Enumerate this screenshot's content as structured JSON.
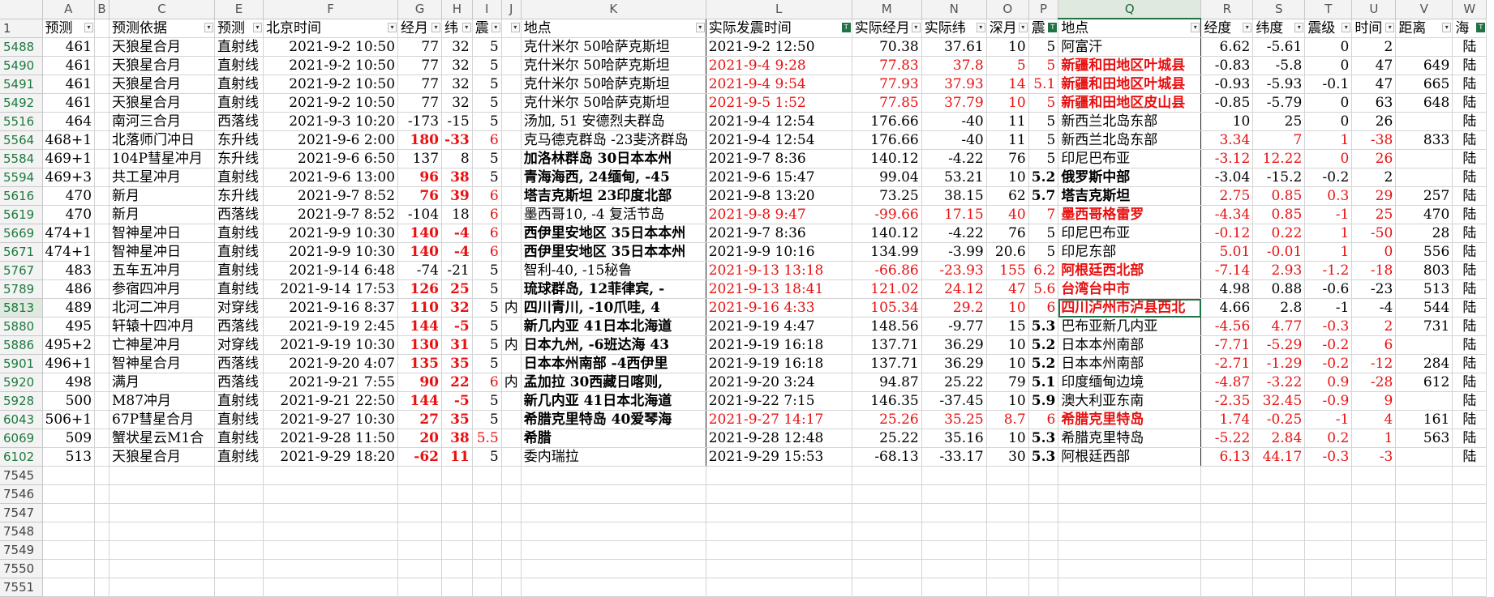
{
  "columns": [
    "A",
    "B",
    "C",
    "E",
    "F",
    "G",
    "H",
    "I",
    "J",
    "K",
    "L",
    "M",
    "N",
    "O",
    "P",
    "Q",
    "R",
    "S",
    "T",
    "U",
    "V",
    "W"
  ],
  "selected_column": "Q",
  "selected_row": "5813",
  "header_row_number": "1",
  "headers": [
    "预测",
    "",
    "预测依据",
    "预测",
    "北京时间",
    "经月",
    "纬",
    "震",
    "",
    "地点",
    "实际发震时间",
    "实际经月",
    "实际纬",
    "深月",
    "震",
    "地点",
    "经度",
    "纬度",
    "震级",
    "时间",
    "距离",
    "海"
  ],
  "filtered_columns": [
    "L",
    "P",
    "W"
  ],
  "rows": [
    {
      "n": "5488",
      "c": [
        "461",
        "",
        "天狼星合月",
        "直射线",
        "2021-9-2 10:50",
        "77",
        "32",
        "5",
        "",
        "克什米尔 50哈萨克斯坦",
        "2021-9-2 12:50",
        "70.38",
        "37.61",
        "10",
        "5",
        "阿富汗",
        "6.62",
        "-5.61",
        "0",
        "2",
        "",
        "陆"
      ]
    },
    {
      "n": "5490",
      "c": [
        "461",
        "",
        "天狼星合月",
        "直射线",
        "2021-9-2 10:50",
        "77",
        "32",
        "5",
        "",
        "克什米尔 50哈萨克斯坦",
        "2021-9-4 9:28",
        "77.83",
        "37.8",
        "5",
        "5",
        "新疆和田地区叶城县",
        "-0.83",
        "-5.8",
        "0",
        "47",
        "649",
        "陆"
      ]
    },
    {
      "n": "5491",
      "c": [
        "461",
        "",
        "天狼星合月",
        "直射线",
        "2021-9-2 10:50",
        "77",
        "32",
        "5",
        "",
        "克什米尔 50哈萨克斯坦",
        "2021-9-4 9:54",
        "77.93",
        "37.93",
        "14",
        "5.1",
        "新疆和田地区叶城县",
        "-0.93",
        "-5.93",
        "-0.1",
        "47",
        "665",
        "陆"
      ]
    },
    {
      "n": "5492",
      "c": [
        "461",
        "",
        "天狼星合月",
        "直射线",
        "2021-9-2 10:50",
        "77",
        "32",
        "5",
        "",
        "克什米尔 50哈萨克斯坦",
        "2021-9-5 1:52",
        "77.85",
        "37.79",
        "10",
        "5",
        "新疆和田地区皮山县",
        "-0.85",
        "-5.79",
        "0",
        "63",
        "648",
        "陆"
      ]
    },
    {
      "n": "5516",
      "c": [
        "464",
        "",
        "南河三合月",
        "西落线",
        "2021-9-3 10:20",
        "-173",
        "-15",
        "5",
        "",
        "汤加, 51 安德烈夫群岛",
        "2021-9-4 12:54",
        "176.66",
        "-40",
        "11",
        "5",
        "新西兰北岛东部",
        "10",
        "25",
        "0",
        "26",
        "",
        "陆"
      ]
    },
    {
      "n": "5564",
      "c": [
        "468+1",
        "",
        "北落师门冲日",
        "东升线",
        "2021-9-6 2:00",
        "180",
        "-33",
        "6",
        "",
        "克马德克群岛 -23斐济群岛",
        "2021-9-4 12:54",
        "176.66",
        "-40",
        "11",
        "5",
        "新西兰北岛东部",
        "3.34",
        "7",
        "1",
        "-38",
        "833",
        "陆"
      ]
    },
    {
      "n": "5584",
      "c": [
        "469+1",
        "",
        "104P彗星冲月",
        "东升线",
        "2021-9-6 6:50",
        "137",
        "8",
        "5",
        "",
        "加洛林群岛 30日本本州",
        "2021-9-7 8:36",
        "140.12",
        "-4.22",
        "76",
        "5",
        "印尼巴布亚",
        "-3.12",
        "12.22",
        "0",
        "26",
        "",
        "陆"
      ]
    },
    {
      "n": "5594",
      "c": [
        "469+3",
        "",
        "共工星冲月",
        "直射线",
        "2021-9-6 13:00",
        "96",
        "38",
        "5",
        "",
        "青海海西, 24缅甸, -45",
        "2021-9-6 15:47",
        "99.04",
        "53.21",
        "10",
        "5.2",
        "俄罗斯中部",
        "-3.04",
        "-15.2",
        "-0.2",
        "2",
        "",
        "陆"
      ]
    },
    {
      "n": "5616",
      "c": [
        "470",
        "",
        "新月",
        "东升线",
        "2021-9-7 8:52",
        "76",
        "39",
        "6",
        "",
        "塔吉克斯坦 23印度北部",
        "2021-9-8 13:20",
        "73.25",
        "38.15",
        "62",
        "5.7",
        "塔吉克斯坦",
        "2.75",
        "0.85",
        "0.3",
        "29",
        "257",
        "陆"
      ]
    },
    {
      "n": "5619",
      "c": [
        "470",
        "",
        "新月",
        "西落线",
        "2021-9-7 8:52",
        "-104",
        "18",
        "6",
        "",
        "墨西哥10, -4 复活节岛",
        "2021-9-8 9:47",
        "-99.66",
        "17.15",
        "40",
        "7",
        "墨西哥格雷罗",
        "-4.34",
        "0.85",
        "-1",
        "25",
        "470",
        "陆"
      ]
    },
    {
      "n": "5669",
      "c": [
        "474+1",
        "",
        "智神星冲日",
        "直射线",
        "2021-9-9 10:30",
        "140",
        "-4",
        "6",
        "",
        "西伊里安地区 35日本本州",
        "2021-9-7 8:36",
        "140.12",
        "-4.22",
        "76",
        "5",
        "印尼巴布亚",
        "-0.12",
        "0.22",
        "1",
        "-50",
        "28",
        "陆"
      ]
    },
    {
      "n": "5671",
      "c": [
        "474+1",
        "",
        "智神星冲日",
        "直射线",
        "2021-9-9 10:30",
        "140",
        "-4",
        "6",
        "",
        "西伊里安地区 35日本本州",
        "2021-9-9 10:16",
        "134.99",
        "-3.99",
        "20.6",
        "5",
        "印尼东部",
        "5.01",
        "-0.01",
        "1",
        "0",
        "556",
        "陆"
      ]
    },
    {
      "n": "5767",
      "c": [
        "483",
        "",
        "五车五冲月",
        "直射线",
        "2021-9-14 6:48",
        "-74",
        "-21",
        "5",
        "",
        "智利-40, -15秘鲁",
        "2021-9-13 13:18",
        "-66.86",
        "-23.93",
        "155",
        "6.2",
        "阿根廷西北部",
        "-7.14",
        "2.93",
        "-1.2",
        "-18",
        "803",
        "陆"
      ]
    },
    {
      "n": "5789",
      "c": [
        "486",
        "",
        "参宿四冲月",
        "直射线",
        "2021-9-14 17:53",
        "126",
        "25",
        "5",
        "",
        "琉球群岛, 12菲律宾, -",
        "2021-9-13 18:41",
        "121.02",
        "24.12",
        "47",
        "5.6",
        "台湾台中市",
        "4.98",
        "0.88",
        "-0.6",
        "-23",
        "513",
        "陆"
      ]
    },
    {
      "n": "5813",
      "c": [
        "489",
        "",
        "北河二冲月",
        "对穿线",
        "2021-9-16 8:37",
        "110",
        "32",
        "5",
        "内",
        "四川青川, -10爪哇, 4",
        "2021-9-16 4:33",
        "105.34",
        "29.2",
        "10",
        "6",
        "四川泸州市泸县西北",
        "4.66",
        "2.8",
        "-1",
        "-4",
        "544",
        "陆"
      ]
    },
    {
      "n": "5880",
      "c": [
        "495",
        "",
        "轩辕十四冲月",
        "西落线",
        "2021-9-19 2:45",
        "144",
        "-5",
        "5",
        "",
        "新几内亚 41日本北海道",
        "2021-9-19 4:47",
        "148.56",
        "-9.77",
        "15",
        "5.3",
        "巴布亚新几内亚",
        "-4.56",
        "4.77",
        "-0.3",
        "2",
        "731",
        "陆"
      ]
    },
    {
      "n": "5886",
      "c": [
        "495+2",
        "",
        "亡神星冲月",
        "对穿线",
        "2021-9-19 10:30",
        "130",
        "31",
        "5",
        "内",
        "日本九州, -6班达海 43",
        "2021-9-19 16:18",
        "137.71",
        "36.29",
        "10",
        "5.2",
        "日本本州南部",
        "-7.71",
        "-5.29",
        "-0.2",
        "6",
        "",
        "陆"
      ]
    },
    {
      "n": "5901",
      "c": [
        "496+1",
        "",
        "智神星合月",
        "西落线",
        "2021-9-20 4:07",
        "135",
        "35",
        "5",
        "",
        "日本本州南部 -4西伊里",
        "2021-9-19 16:18",
        "137.71",
        "36.29",
        "10",
        "5.2",
        "日本本州南部",
        "-2.71",
        "-1.29",
        "-0.2",
        "-12",
        "284",
        "陆"
      ]
    },
    {
      "n": "5920",
      "c": [
        "498",
        "",
        "满月",
        "西落线",
        "2021-9-21 7:55",
        "90",
        "22",
        "6",
        "内",
        "孟加拉 30西藏日喀则,",
        "2021-9-20 3:24",
        "94.87",
        "25.22",
        "79",
        "5.1",
        "印度缅甸边境",
        "-4.87",
        "-3.22",
        "0.9",
        "-28",
        "612",
        "陆"
      ]
    },
    {
      "n": "5928",
      "c": [
        "500",
        "",
        "M87冲月",
        "直射线",
        "2021-9-21 22:50",
        "144",
        "-5",
        "5",
        "",
        "新几内亚 41日本北海道",
        "2021-9-22 7:15",
        "146.35",
        "-37.45",
        "10",
        "5.9",
        "澳大利亚东南",
        "-2.35",
        "32.45",
        "-0.9",
        "9",
        "",
        "陆"
      ]
    },
    {
      "n": "6043",
      "c": [
        "506+1",
        "",
        "67P彗星合月",
        "直射线",
        "2021-9-27 10:30",
        "27",
        "35",
        "5",
        "",
        "希腊克里特岛 40爱琴海",
        "2021-9-27 14:17",
        "25.26",
        "35.25",
        "8.7",
        "6",
        "希腊克里特岛",
        "1.74",
        "-0.25",
        "-1",
        "4",
        "161",
        "陆"
      ]
    },
    {
      "n": "6069",
      "c": [
        "509",
        "",
        "蟹状星云M1合",
        "直射线",
        "2021-9-28 11:50",
        "20",
        "38",
        "5.5",
        "",
        "希腊",
        "2021-9-28 12:48",
        "25.22",
        "35.16",
        "10",
        "5.3",
        "希腊克里特岛",
        "-5.22",
        "2.84",
        "0.2",
        "1",
        "563",
        "陆"
      ]
    },
    {
      "n": "6102",
      "c": [
        "513",
        "",
        "天狼星合月",
        "直射线",
        "2021-9-29 18:20",
        "-62",
        "11",
        "5",
        "",
        "委内瑞拉",
        "2021-9-29 15:53",
        "-68.13",
        "-33.17",
        "30",
        "5.3",
        "阿根廷西部",
        "6.13",
        "44.17",
        "-0.3",
        "-3",
        "",
        "陆"
      ]
    }
  ],
  "empty_row_numbers": [
    "7545",
    "7546",
    "7547",
    "7548",
    "7549",
    "7550",
    "7551"
  ]
}
